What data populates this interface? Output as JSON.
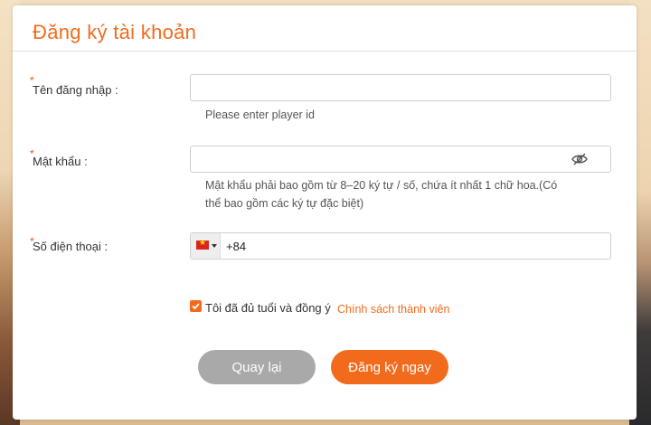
{
  "form": {
    "title": "Đăng ký tài khoản",
    "required_mark": "*",
    "username": {
      "label": "Tên đăng nhập :",
      "value": "",
      "hint": "Please enter player id"
    },
    "password": {
      "label": "Mật khẩu :",
      "value": "",
      "hint_line1": "Mật khẩu phải bao gồm từ 8–20 ký tự / số, chứa ít nhất 1 chữ hoa.(Có",
      "hint_line2": "thể bao gồm các ký tự đặc biệt)",
      "toggle_icon": "eye-slash-icon"
    },
    "phone": {
      "label": "Số điện thoại :",
      "country_flag": "vietnam-flag-icon",
      "value": "+84"
    },
    "agree": {
      "checked": true,
      "text": "Tôi đã đủ tuổi và đồng ý",
      "link_text": "Chính sách thành viên"
    },
    "buttons": {
      "back": "Quay lại",
      "submit": "Đăng ký ngay"
    }
  },
  "colors": {
    "accent": "#f26b1d",
    "back_button": "#a9a9a9",
    "required": "#e8501c"
  }
}
